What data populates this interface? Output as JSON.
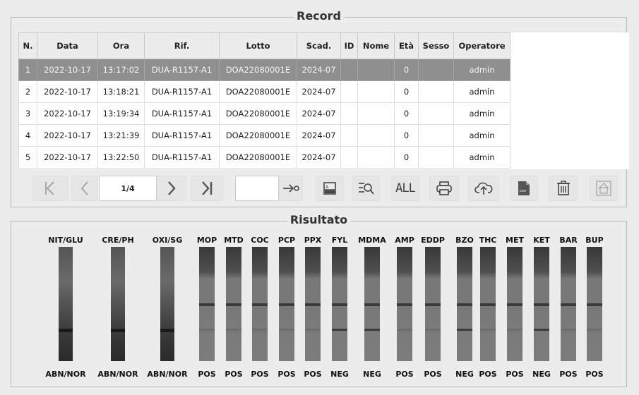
{
  "record": {
    "title": "Record",
    "columns": [
      "N.",
      "Data",
      "Ora",
      "Rif.",
      "Lotto",
      "Scad.",
      "ID",
      "Nome",
      "Età",
      "Sesso",
      "Operatore"
    ],
    "rows": [
      [
        "1",
        "2022-10-17",
        "13:17:02",
        "DUA-R1157-A1",
        "DOA22080001E",
        "2024-07",
        "",
        "",
        "0",
        "",
        "admin"
      ],
      [
        "2",
        "2022-10-17",
        "13:18:21",
        "DUA-R1157-A1",
        "DOA22080001E",
        "2024-07",
        "",
        "",
        "0",
        "",
        "admin"
      ],
      [
        "3",
        "2022-10-17",
        "13:19:34",
        "DUA-R1157-A1",
        "DOA22080001E",
        "2024-07",
        "",
        "",
        "0",
        "",
        "admin"
      ],
      [
        "4",
        "2022-10-17",
        "13:21:39",
        "DUA-R1157-A1",
        "DOA22080001E",
        "2024-07",
        "",
        "",
        "0",
        "",
        "admin"
      ],
      [
        "5",
        "2022-10-17",
        "13:22:50",
        "DUA-R1157-A1",
        "DOA22080001E",
        "2024-07",
        "",
        "",
        "0",
        "",
        "admin"
      ]
    ],
    "selected_row": 0
  },
  "toolbar": {
    "page_indicator": "1/4",
    "goto_value": "",
    "icons": [
      "first-page-icon",
      "prev-page-icon",
      "next-page-icon",
      "last-page-icon",
      "goto-icon",
      "export-image-icon",
      "search-icon",
      "all-icon",
      "print-icon",
      "upload-icon",
      "csv-icon",
      "delete-icon",
      "home-icon"
    ],
    "all_label": "ALL",
    "csv_label": "csv"
  },
  "result": {
    "title": "Risultato",
    "tests": [
      {
        "name": "NIT/GLU",
        "result": "ABN/NOR"
      },
      {
        "name": "CRE/PH",
        "result": "ABN/NOR"
      },
      {
        "name": "OXI/SG",
        "result": "ABN/NOR"
      },
      {
        "name": "MOP",
        "result": "POS"
      },
      {
        "name": "MTD",
        "result": "POS"
      },
      {
        "name": "COC",
        "result": "POS"
      },
      {
        "name": "PCP",
        "result": "POS"
      },
      {
        "name": "PPX",
        "result": "POS"
      },
      {
        "name": "FYL",
        "result": "NEG"
      },
      {
        "name": "MDMA",
        "result": "NEG"
      },
      {
        "name": "AMP",
        "result": "POS"
      },
      {
        "name": "EDDP",
        "result": "POS"
      },
      {
        "name": "BZO",
        "result": "NEG"
      },
      {
        "name": "THC",
        "result": "POS"
      },
      {
        "name": "MET",
        "result": "POS"
      },
      {
        "name": "KET",
        "result": "NEG"
      },
      {
        "name": "BAR",
        "result": "POS"
      },
      {
        "name": "BUP",
        "result": "POS"
      }
    ]
  }
}
